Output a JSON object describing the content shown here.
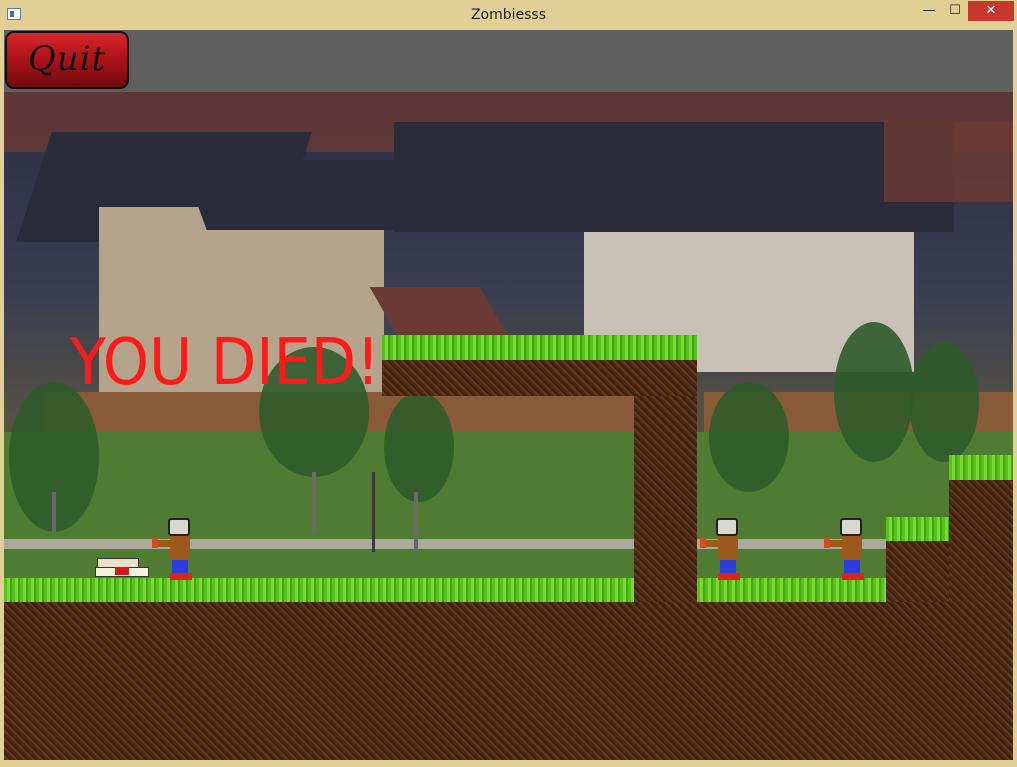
{
  "window": {
    "title": "Zombiesss",
    "controls": {
      "minimize": "—",
      "maximize": "☐",
      "close": "✕"
    }
  },
  "toolbar": {
    "quit_label": "Quit"
  },
  "game": {
    "message": "YOU DIED!",
    "zombie_count": 3
  },
  "colors": {
    "message": "#ff1a1a",
    "grass": "#57c21c",
    "dirt": "#4a2a14",
    "quit_button": "#b0141a"
  }
}
